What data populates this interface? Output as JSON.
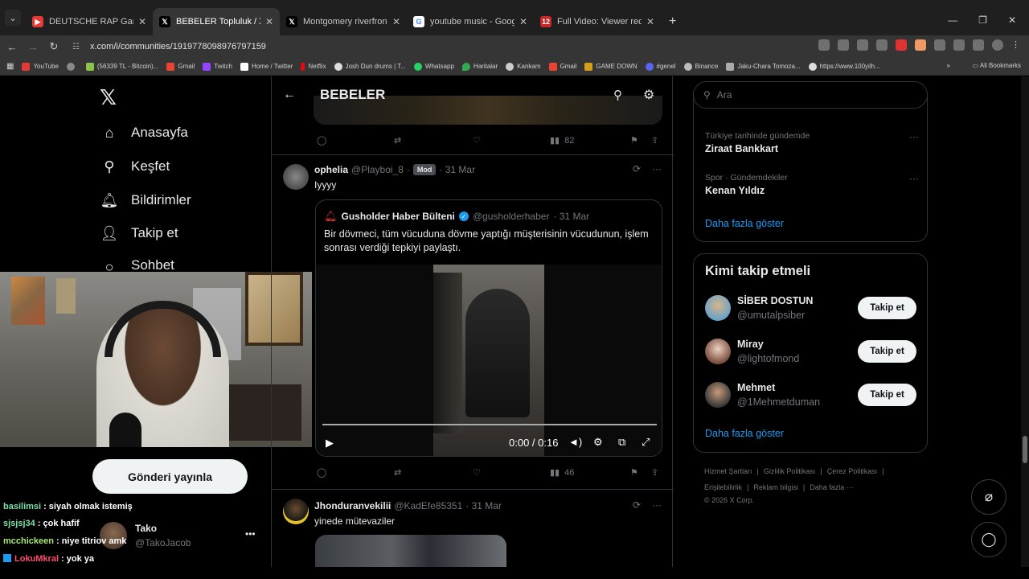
{
  "tabs": [
    {
      "title": "DEUTSCHE RAP Gankster Brude",
      "fav_color": "#e53935",
      "fav_glyph": "▶"
    },
    {
      "title": "BEBELER Topluluk / X",
      "fav_color": "#000000",
      "fav_glyph": "𝕏"
    },
    {
      "title": "Montgomery riverfront brawl -",
      "fav_color": "#000000",
      "fav_glyph": "𝕏"
    },
    {
      "title": "youtube music - Google'da Ara",
      "fav_color": "#4285f4",
      "fav_glyph": "G"
    },
    {
      "title": "Full Video: Viewer records as M",
      "fav_color": "#c62828",
      "fav_glyph": "12"
    }
  ],
  "address": "x.com/i/communities/1919778098976797159",
  "bookmarks": [
    {
      "label": "YouTube",
      "color": "#e53935"
    },
    {
      "label": "",
      "color": "#888888"
    },
    {
      "label": "(56339 TL - Bitcoin)...",
      "color": "#8bc34a"
    },
    {
      "label": "Gmail",
      "color": "#ea4335"
    },
    {
      "label": "Twitch",
      "color": "#9146ff"
    },
    {
      "label": "Home / Twitter",
      "color": "#ffffff"
    },
    {
      "label": "Netflix",
      "color": "#e50914"
    },
    {
      "label": "Josh Dun drums | T...",
      "color": "#dddddd"
    },
    {
      "label": "Whatsapp",
      "color": "#25d366"
    },
    {
      "label": "Haritalar",
      "color": "#34a853"
    },
    {
      "label": "Kankam",
      "color": "#cccccc"
    },
    {
      "label": "Gmail",
      "color": "#ea4335"
    },
    {
      "label": "GAME DOWN",
      "color": "#d4a017"
    },
    {
      "label": "#genel",
      "color": "#5865f2"
    },
    {
      "label": "Binance",
      "color": "#bbbbbb"
    },
    {
      "label": "Jaku-Chara Tomoza...",
      "color": "#aaaaaa"
    },
    {
      "label": "https://www.100yilh...",
      "color": "#dddddd"
    }
  ],
  "all_bookmarks": "All Bookmarks",
  "nav": {
    "home": "Anasayfa",
    "explore": "Keşfet",
    "notifications": "Bildirimler",
    "follow": "Takip et",
    "chat": "Sohbet",
    "post_button": "Gönderi yayınla"
  },
  "account": {
    "name": "Tako",
    "handle": "@TakoJacob"
  },
  "chat_messages": [
    {
      "user": "basilimsi",
      "user_color": "#7be0a8",
      "text": ": siyah olmak istemiş"
    },
    {
      "user": "sjsjsj34",
      "user_color": "#7be0a8",
      "text": ": çok hafif"
    },
    {
      "user": "mcchickeen",
      "user_color": "#a6e87a",
      "text": ": niye titriov amk"
    },
    {
      "user": "LokuMkral",
      "user_color": "#ff4d6d",
      "text": ": yok ya"
    }
  ],
  "feed": {
    "title": "BEBELER",
    "top_post_views": "82",
    "posts": [
      {
        "name": "ophelia",
        "handle": "@Playboi_8",
        "badge": "Mod",
        "date": "· 31 Mar",
        "text": "Iyyyy",
        "views": "46",
        "quote": {
          "name": "Gusholder Haber Bülteni",
          "handle": "@gusholderhaber",
          "date": "· 31 Mar",
          "text": "Bir dövmeci, tüm vücuduna dövme yaptığı müşterisinin vücudunun, işlem sonrası verdiği tepkiyi paylaştı.",
          "video_time": "0:00 / 0:16"
        }
      },
      {
        "name": "Jhonduranvekilii",
        "handle": "@KadEfe85351",
        "date": "· 31 Mar",
        "text": "yinede mütevaziler"
      }
    ]
  },
  "search_placeholder": "Ara",
  "trends": [
    {
      "category": "Türkiye tarihinde gündemde",
      "title": "Ziraat Bankkart"
    },
    {
      "category": "Spor · Gündemdekiler",
      "title": "Kenan Yıldız"
    }
  ],
  "show_more": "Daha fazla göster",
  "who_to_follow": {
    "title": "Kimi takip etmeli",
    "button": "Takip et",
    "users": [
      {
        "name": "SİBER DOSTUN",
        "handle": "@umutalpsiber"
      },
      {
        "name": "Miray",
        "handle": "@lightofmond"
      },
      {
        "name": "Mehmet",
        "handle": "@1Mehmetduman"
      }
    ]
  },
  "footer": {
    "links1": [
      "Hizmet Şartları",
      "|",
      "Gizlilik Politikası",
      "|",
      "Çerez Politikası",
      "|"
    ],
    "links2": [
      "Erişilebilirlik",
      "|",
      "Reklam bilgisi",
      "|",
      "Daha fazla ···"
    ],
    "copyright": "© 2026 X Corp."
  },
  "colors": {
    "accent": "#1d9bf0",
    "background": "#000000",
    "border": "#2f3336",
    "muted": "#71767b"
  }
}
